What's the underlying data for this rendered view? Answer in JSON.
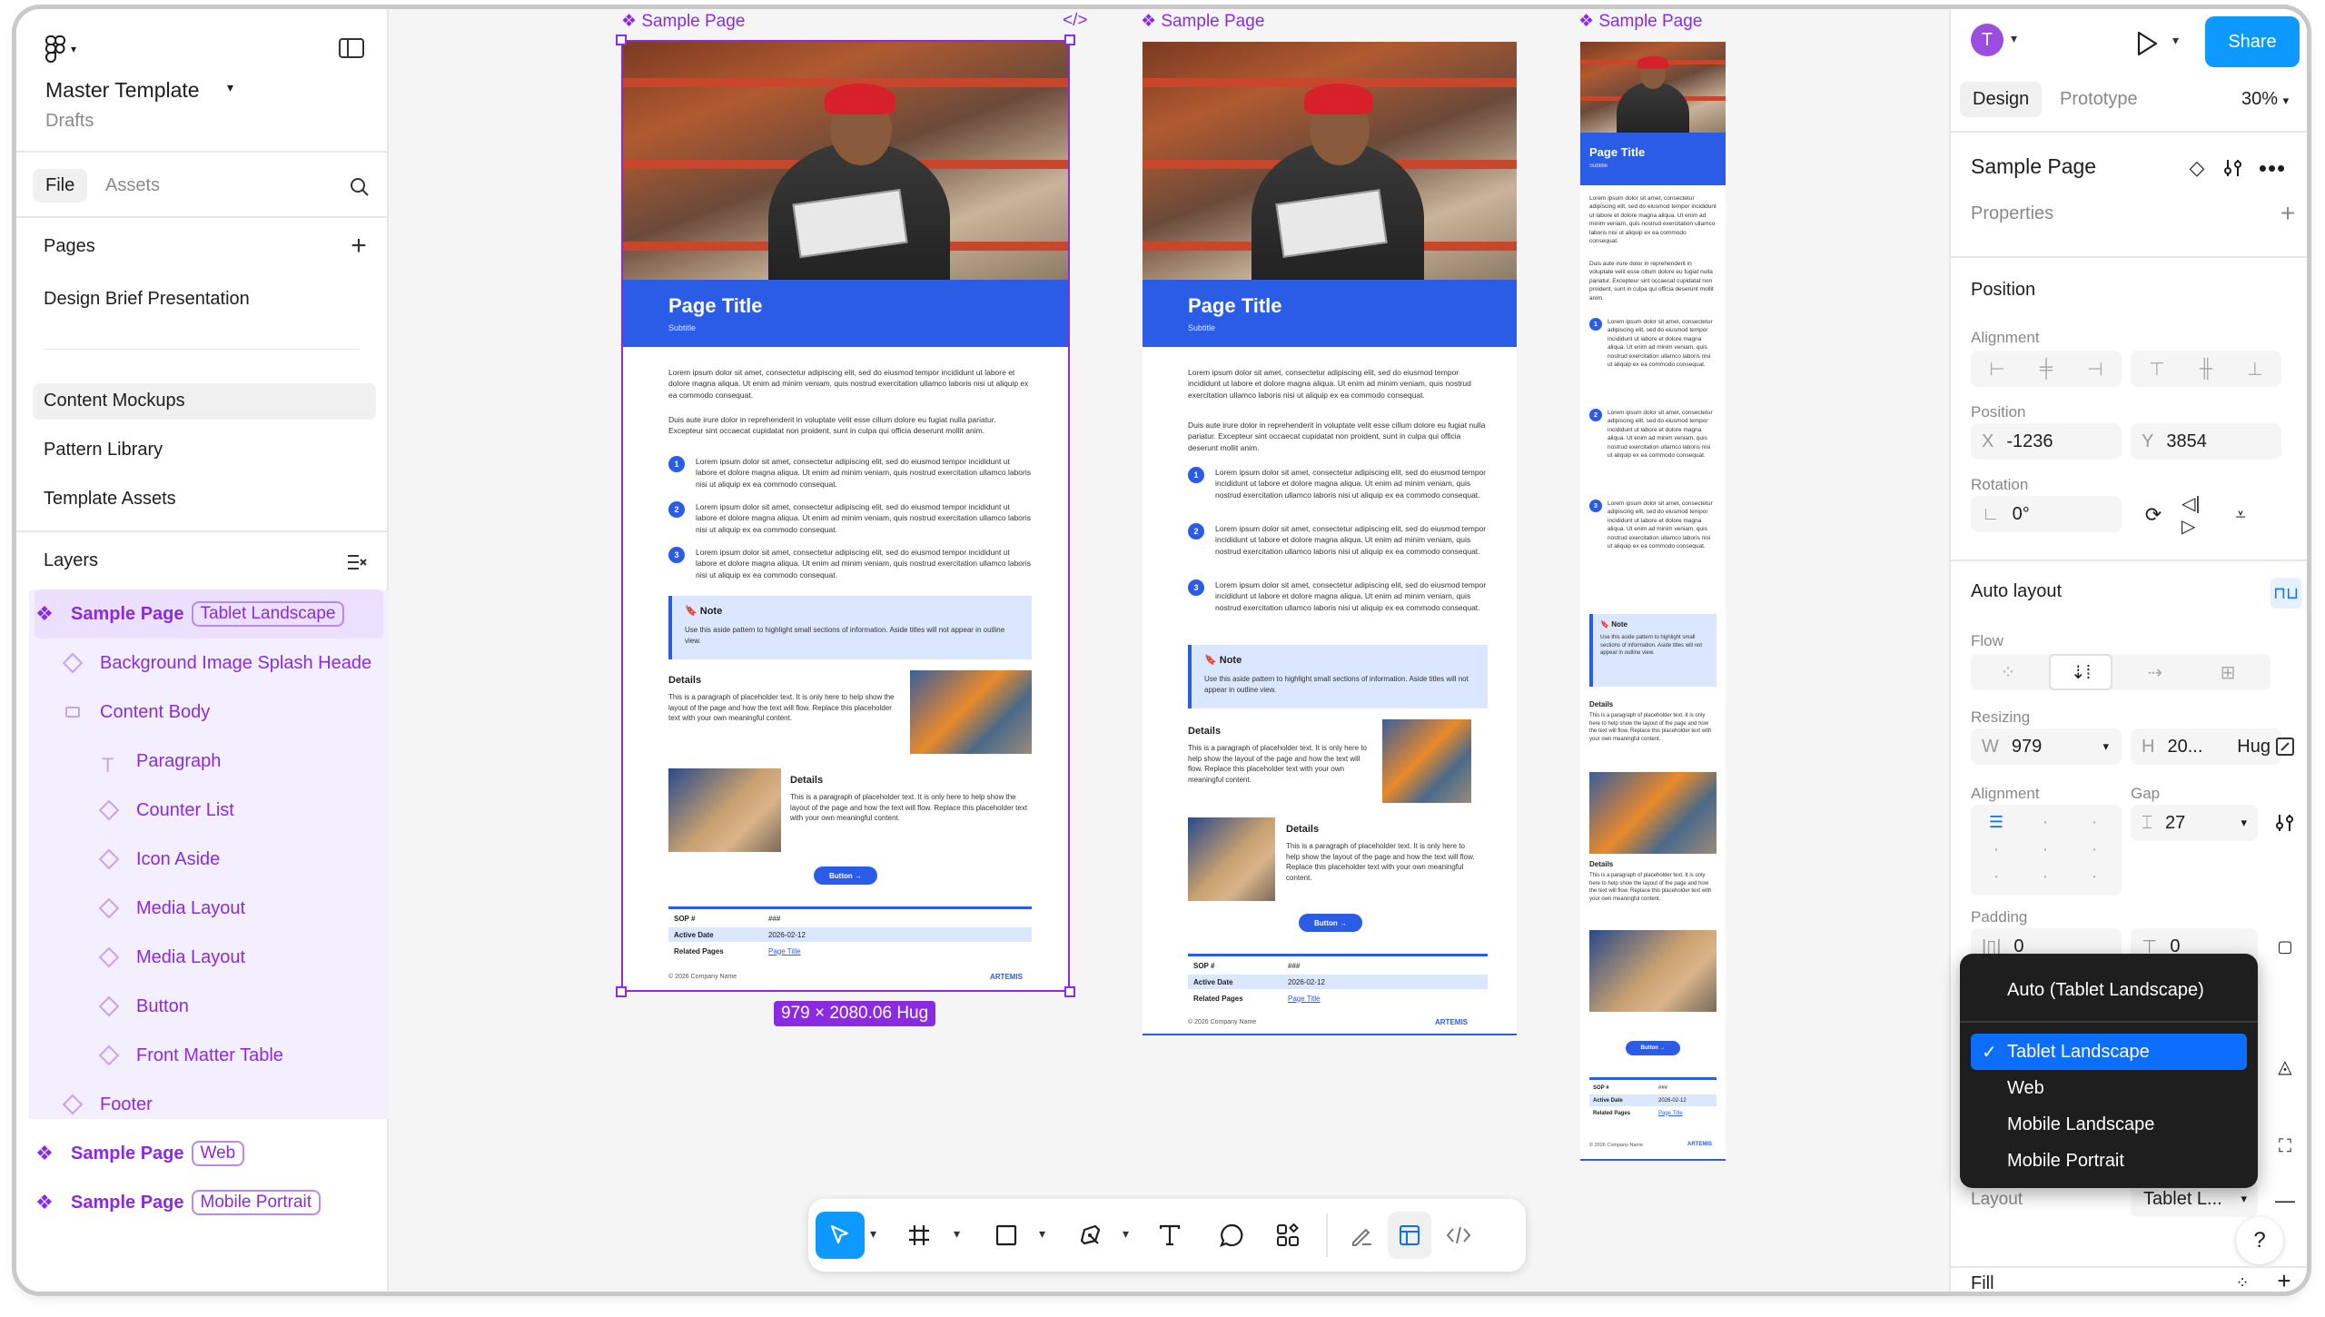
{
  "file": {
    "name": "Master Template",
    "location": "Drafts"
  },
  "left_tabs": {
    "file": "File",
    "assets": "Assets"
  },
  "pages": {
    "heading": "Pages",
    "items": [
      "Design Brief Presentation",
      "Content Mockups",
      "Pattern Library",
      "Template Assets"
    ]
  },
  "layers": {
    "heading": "Layers",
    "items": [
      {
        "label": "Sample Page",
        "tag": "Tablet Landscape"
      },
      {
        "label": "Background Image Splash Heade"
      },
      {
        "label": "Content Body"
      },
      {
        "label": "Paragraph"
      },
      {
        "label": "Counter List"
      },
      {
        "label": "Icon Aside"
      },
      {
        "label": "Media Layout"
      },
      {
        "label": "Media Layout"
      },
      {
        "label": "Button"
      },
      {
        "label": "Front Matter Table"
      },
      {
        "label": "Footer"
      },
      {
        "label": "Sample Page",
        "tag": "Web"
      },
      {
        "label": "Sample Page",
        "tag": "Mobile Portrait"
      }
    ]
  },
  "canvas": {
    "frame_label": "Sample Page",
    "size_badge": "979 × 2080.06 Hug",
    "page": {
      "title": "Page Title",
      "subtitle": "Subtitle",
      "para1": "Lorem ipsum dolor sit amet, consectetur adipiscing elit, sed do eiusmod tempor incididunt ut labore et dolore magna aliqua. Ut enim ad minim veniam, quis nostrud exercitation ullamco laboris nisi ut aliquip ex ea commodo consequat.",
      "para2": "Duis aute irure dolor in reprehenderit in voluptate velit esse cillum dolore eu fugiat nulla pariatur. Excepteur sint occaecat cupidatat non proident, sunt in culpa qui officia deserunt mollit anim.",
      "list_item": "Lorem ipsum dolor sit amet, consectetur adipiscing elit, sed do eiusmod tempor incididunt ut labore et dolore magna aliqua. Ut enim ad minim veniam, quis nostrud exercitation ullamco laboris nisi ut aliquip ex ea commodo consequat.",
      "counters": [
        "1",
        "2",
        "3"
      ],
      "note_title": "Note",
      "note_text": "Use this aside pattern to highlight small sections of information. Aside titles will not appear in outline view.",
      "details_title": "Details",
      "details_text": "This is a paragraph of placeholder text. It is only here to help show the layout of the page and how the text will flow. Replace this placeholder text with your own meaningful content.",
      "button": "Button →",
      "table": [
        [
          "SOP #",
          "###"
        ],
        [
          "Active Date",
          "2026-02-12"
        ],
        [
          "Related Pages",
          "Page Title"
        ]
      ],
      "footer_copy": "© 2026 Company Name",
      "footer_brand": "ARTEMIS"
    }
  },
  "right": {
    "avatar": "T",
    "share": "Share",
    "tabs": {
      "design": "Design",
      "prototype": "Prototype"
    },
    "zoom": "30%",
    "selection": "Sample Page",
    "properties": "Properties",
    "position_heading": "Position",
    "alignment": "Alignment",
    "position": "Position",
    "x_label": "X",
    "x": "-1236",
    "y_label": "Y",
    "y": "3854",
    "rotation": "Rotation",
    "rotation_value": "0°",
    "auto_layout": "Auto layout",
    "flow": "Flow",
    "resizing": "Resizing",
    "w_label": "W",
    "w": "979",
    "h_label": "H",
    "h": "20...",
    "h_mode": "Hug",
    "alignment2": "Alignment",
    "gap": "Gap",
    "gap_value": "27",
    "padding": "Padding",
    "pad_h": "0",
    "pad_v": "0",
    "layout_label": "Layout",
    "layout_value": "Tablet L...",
    "fill": "Fill",
    "help": "?"
  },
  "menu": {
    "header": "Auto (Tablet Landscape)",
    "items": [
      {
        "label": "Tablet Landscape",
        "selected": true
      },
      {
        "label": "Web"
      },
      {
        "label": "Mobile Landscape"
      },
      {
        "label": "Mobile Portrait"
      }
    ]
  },
  "colors": {
    "accent": "#2b5ce6",
    "component": "#8a2be2",
    "primary": "#0d6efd"
  }
}
